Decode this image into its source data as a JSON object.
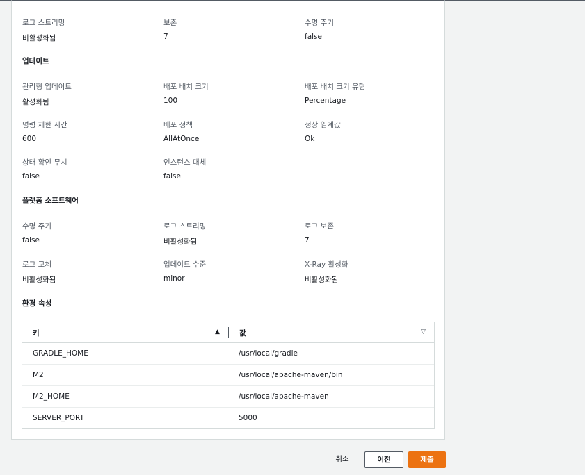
{
  "sections": {
    "top": {
      "fields": [
        {
          "label": "로그 스트리밍",
          "value": "비활성화됨"
        },
        {
          "label": "보존",
          "value": "7"
        },
        {
          "label": "수명 주기",
          "value": "false"
        }
      ]
    },
    "updates": {
      "title": "업데이트",
      "fields": [
        {
          "label": "관리형 업데이트",
          "value": "활성화됨"
        },
        {
          "label": "배포 배치 크기",
          "value": "100"
        },
        {
          "label": "배포 배치 크기 유형",
          "value": "Percentage"
        },
        {
          "label": "명령 제한 시간",
          "value": "600"
        },
        {
          "label": "배포 정책",
          "value": "AllAtOnce"
        },
        {
          "label": "정상 임계값",
          "value": "Ok"
        },
        {
          "label": "상태 확인 무시",
          "value": "false"
        },
        {
          "label": "인스턴스 대체",
          "value": "false"
        }
      ]
    },
    "platform": {
      "title": "플랫폼 소프트웨어",
      "fields": [
        {
          "label": "수명 주기",
          "value": "false"
        },
        {
          "label": "로그 스트리밍",
          "value": "비활성화됨"
        },
        {
          "label": "로그 보존",
          "value": "7"
        },
        {
          "label": "로그 교체",
          "value": "비활성화됨"
        },
        {
          "label": "업데이트 수준",
          "value": "minor"
        },
        {
          "label": "X-Ray 활성화",
          "value": "비활성화됨"
        }
      ]
    },
    "env": {
      "title": "환경 속성",
      "headers": {
        "key": "키",
        "value": "값"
      },
      "rows": [
        {
          "key": "GRADLE_HOME",
          "value": "/usr/local/gradle"
        },
        {
          "key": "M2",
          "value": "/usr/local/apache-maven/bin"
        },
        {
          "key": "M2_HOME",
          "value": "/usr/local/apache-maven"
        },
        {
          "key": "SERVER_PORT",
          "value": "5000"
        }
      ]
    }
  },
  "footer": {
    "cancel_label": "취소",
    "prev_label": "이전",
    "submit_label": "제출"
  },
  "colors": {
    "accent": "#ec7211",
    "page_bg": "#f2f3f3",
    "label": "#545b64"
  }
}
